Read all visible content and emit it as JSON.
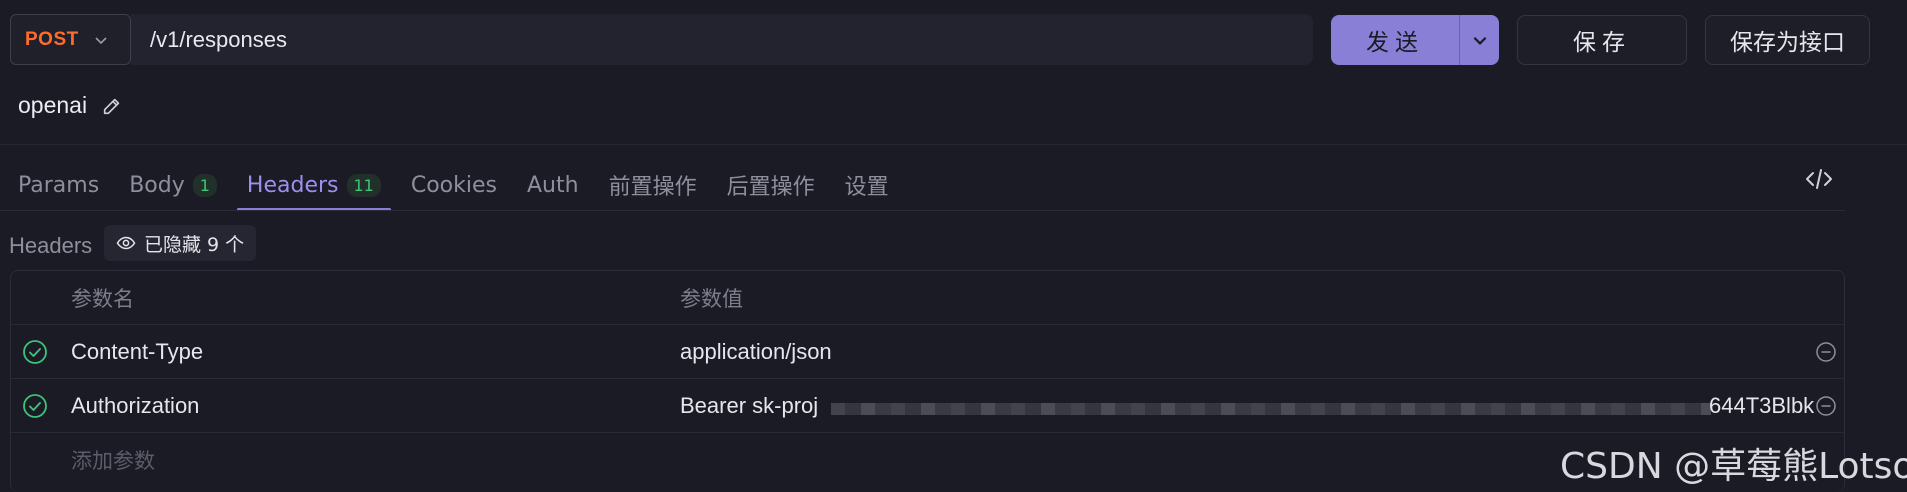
{
  "request": {
    "method": "POST",
    "url": "/v1/responses",
    "send_label": "发送",
    "save_label": "保存",
    "save_as_label": "保存为接口"
  },
  "api_name": "openai",
  "tabs": [
    {
      "label": "Params",
      "badge": ""
    },
    {
      "label": "Body",
      "badge": "1"
    },
    {
      "label": "Headers",
      "badge": "11",
      "active": true
    },
    {
      "label": "Cookies",
      "badge": ""
    },
    {
      "label": "Auth",
      "badge": ""
    },
    {
      "label": "前置操作",
      "badge": ""
    },
    {
      "label": "后置操作",
      "badge": ""
    },
    {
      "label": "设置",
      "badge": ""
    }
  ],
  "headers_section": {
    "label": "Headers",
    "hidden_text": "已隐藏 9 个"
  },
  "table": {
    "col_name": "参数名",
    "col_value": "参数值",
    "rows": [
      {
        "name": "Content-Type",
        "value": "application/json",
        "enabled": true
      },
      {
        "name": "Authorization",
        "value_prefix": "Bearer sk-proj",
        "value_suffix": "644T3Blbk",
        "enabled": true
      }
    ],
    "add_placeholder": "添加参数"
  },
  "watermark": "CSDN @草莓熊Lotso",
  "colors": {
    "accent": "#8a7fd6",
    "method": "#ff6b2c",
    "success": "#3cc47a",
    "background": "#1b1b25"
  },
  "icons": [
    "chevron-down-icon",
    "edit-icon",
    "code-icon",
    "eye-icon",
    "check-circle-icon",
    "remove-circle-icon"
  ]
}
